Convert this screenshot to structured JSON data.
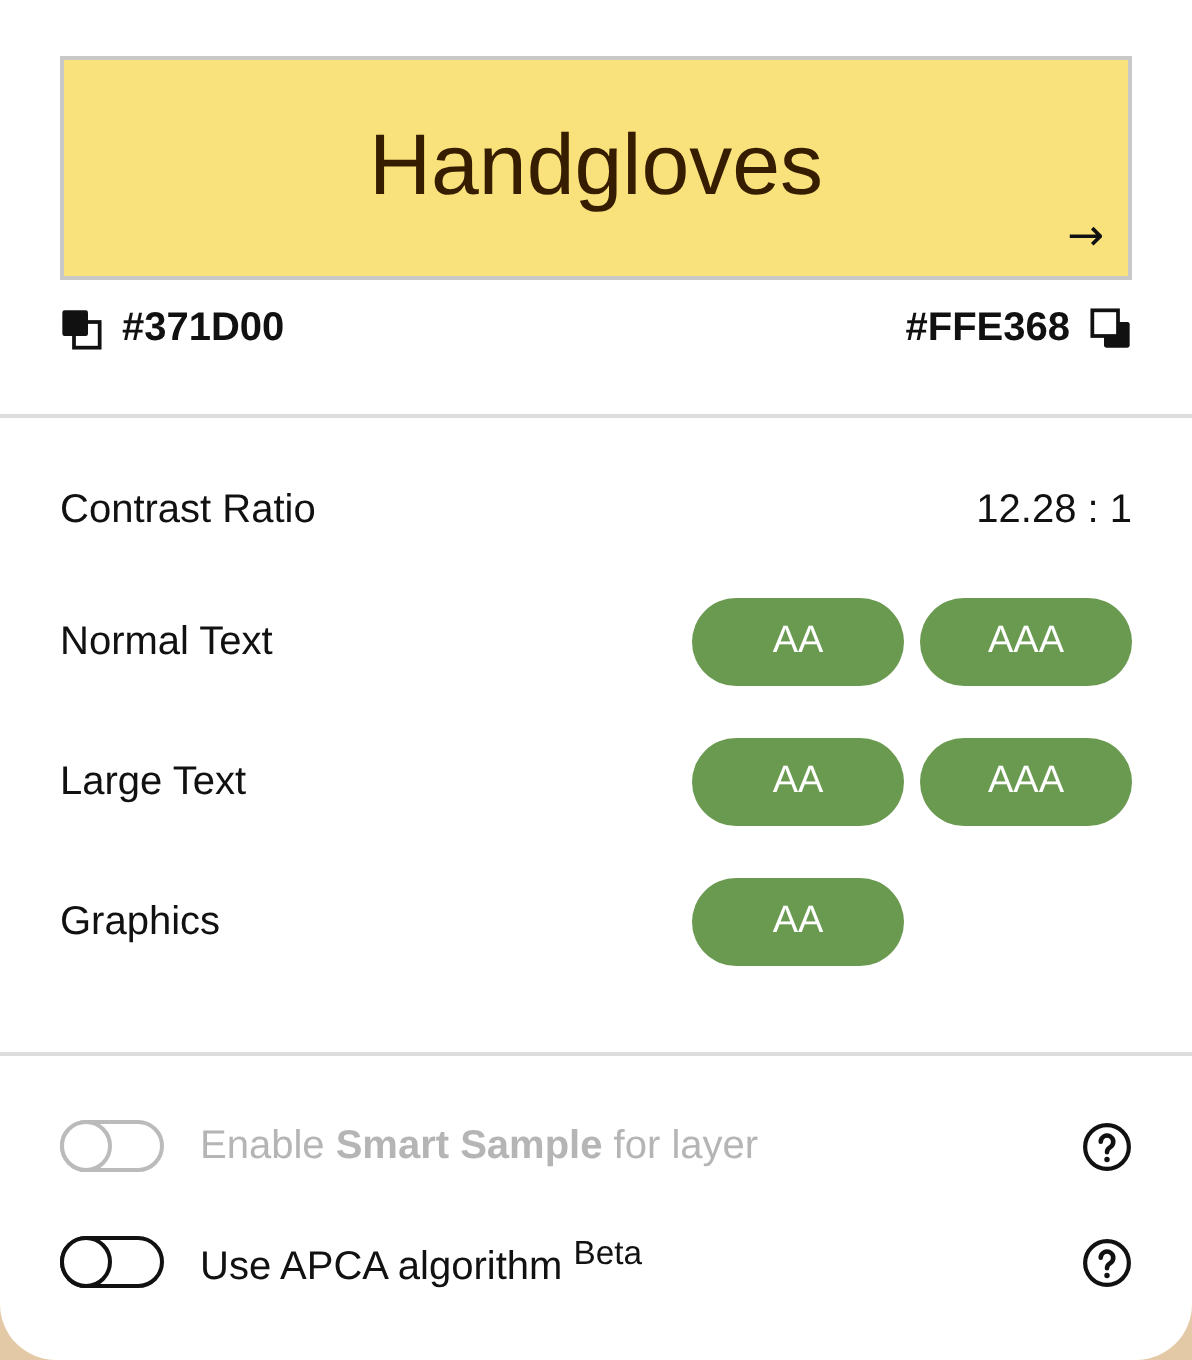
{
  "preview": {
    "sample": "Handgloves",
    "arrow": "→"
  },
  "colors": {
    "foreground": "#371D00",
    "background": "#FFE368"
  },
  "contrast": {
    "label": "Contrast Ratio",
    "value": "12.28 : 1"
  },
  "levels": [
    {
      "label": "Normal Text",
      "badges": [
        {
          "text": "AA",
          "pass": true
        },
        {
          "text": "AAA",
          "pass": true
        }
      ]
    },
    {
      "label": "Large Text",
      "badges": [
        {
          "text": "AA",
          "pass": true
        },
        {
          "text": "AAA",
          "pass": true
        }
      ]
    },
    {
      "label": "Graphics",
      "badges": [
        {
          "text": "AA",
          "pass": true
        }
      ]
    }
  ],
  "options": [
    {
      "label": "Enable **Smart Sample** for layer",
      "on": false,
      "disabled": true
    },
    {
      "label": "Use APCA algorithm $^{Beta}$",
      "on": false,
      "disabled": false
    }
  ]
}
